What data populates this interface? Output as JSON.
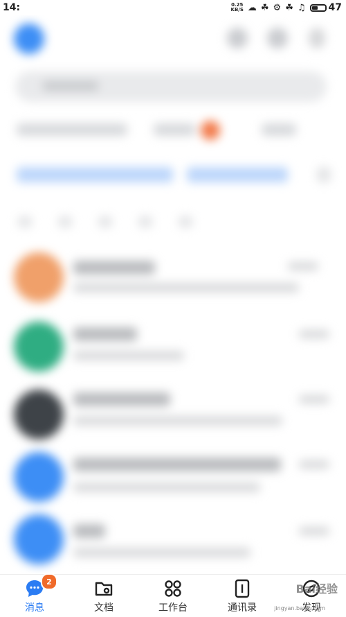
{
  "status_bar": {
    "time": "14:",
    "net_speed_value": "0.25",
    "net_speed_unit": "KB/S",
    "battery_level": "47"
  },
  "tabs": [
    {
      "label": "消息",
      "icon": "message-icon",
      "active": true,
      "badge": "2"
    },
    {
      "label": "文档",
      "icon": "folder-icon",
      "active": false
    },
    {
      "label": "工作台",
      "icon": "grid-icon",
      "active": false
    },
    {
      "label": "通讯录",
      "icon": "contacts-icon",
      "active": false
    },
    {
      "label": "发现",
      "icon": "compass-icon",
      "active": false
    }
  ],
  "watermark": {
    "text": "Bai经验",
    "sub": "jingyan.baidu.com"
  },
  "colors": {
    "accent": "#2b7cf3",
    "badge": "#f06a2a"
  }
}
